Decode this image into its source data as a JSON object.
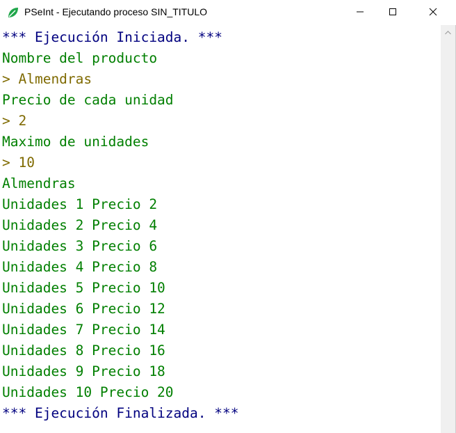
{
  "window": {
    "title": "PSeInt - Ejecutando proceso SIN_TITULO",
    "icon": "pseint-leaf-icon",
    "controls": {
      "minimize_icon": "minimize-icon",
      "maximize_icon": "maximize-icon",
      "close_icon": "close-icon"
    }
  },
  "colors": {
    "system": "#00007f",
    "output": "#007f00",
    "input": "#7f6a00",
    "icon_green": "#1fa64a"
  },
  "console": {
    "lines": [
      {
        "text": "*** Ejecución Iniciada. ***",
        "kind": "system"
      },
      {
        "text": "Nombre del producto",
        "kind": "output"
      },
      {
        "text": "> Almendras",
        "kind": "input"
      },
      {
        "text": "Precio de cada unidad",
        "kind": "output"
      },
      {
        "text": "> 2",
        "kind": "input"
      },
      {
        "text": "Maximo de unidades",
        "kind": "output"
      },
      {
        "text": "> 10",
        "kind": "input"
      },
      {
        "text": "Almendras",
        "kind": "output"
      },
      {
        "text": "Unidades 1 Precio 2",
        "kind": "output"
      },
      {
        "text": "Unidades 2 Precio 4",
        "kind": "output"
      },
      {
        "text": "Unidades 3 Precio 6",
        "kind": "output"
      },
      {
        "text": "Unidades 4 Precio 8",
        "kind": "output"
      },
      {
        "text": "Unidades 5 Precio 10",
        "kind": "output"
      },
      {
        "text": "Unidades 6 Precio 12",
        "kind": "output"
      },
      {
        "text": "Unidades 7 Precio 14",
        "kind": "output"
      },
      {
        "text": "Unidades 8 Precio 16",
        "kind": "output"
      },
      {
        "text": "Unidades 9 Precio 18",
        "kind": "output"
      },
      {
        "text": "Unidades 10 Precio 20",
        "kind": "output"
      },
      {
        "text": "*** Ejecución Finalizada. ***",
        "kind": "system"
      }
    ]
  }
}
